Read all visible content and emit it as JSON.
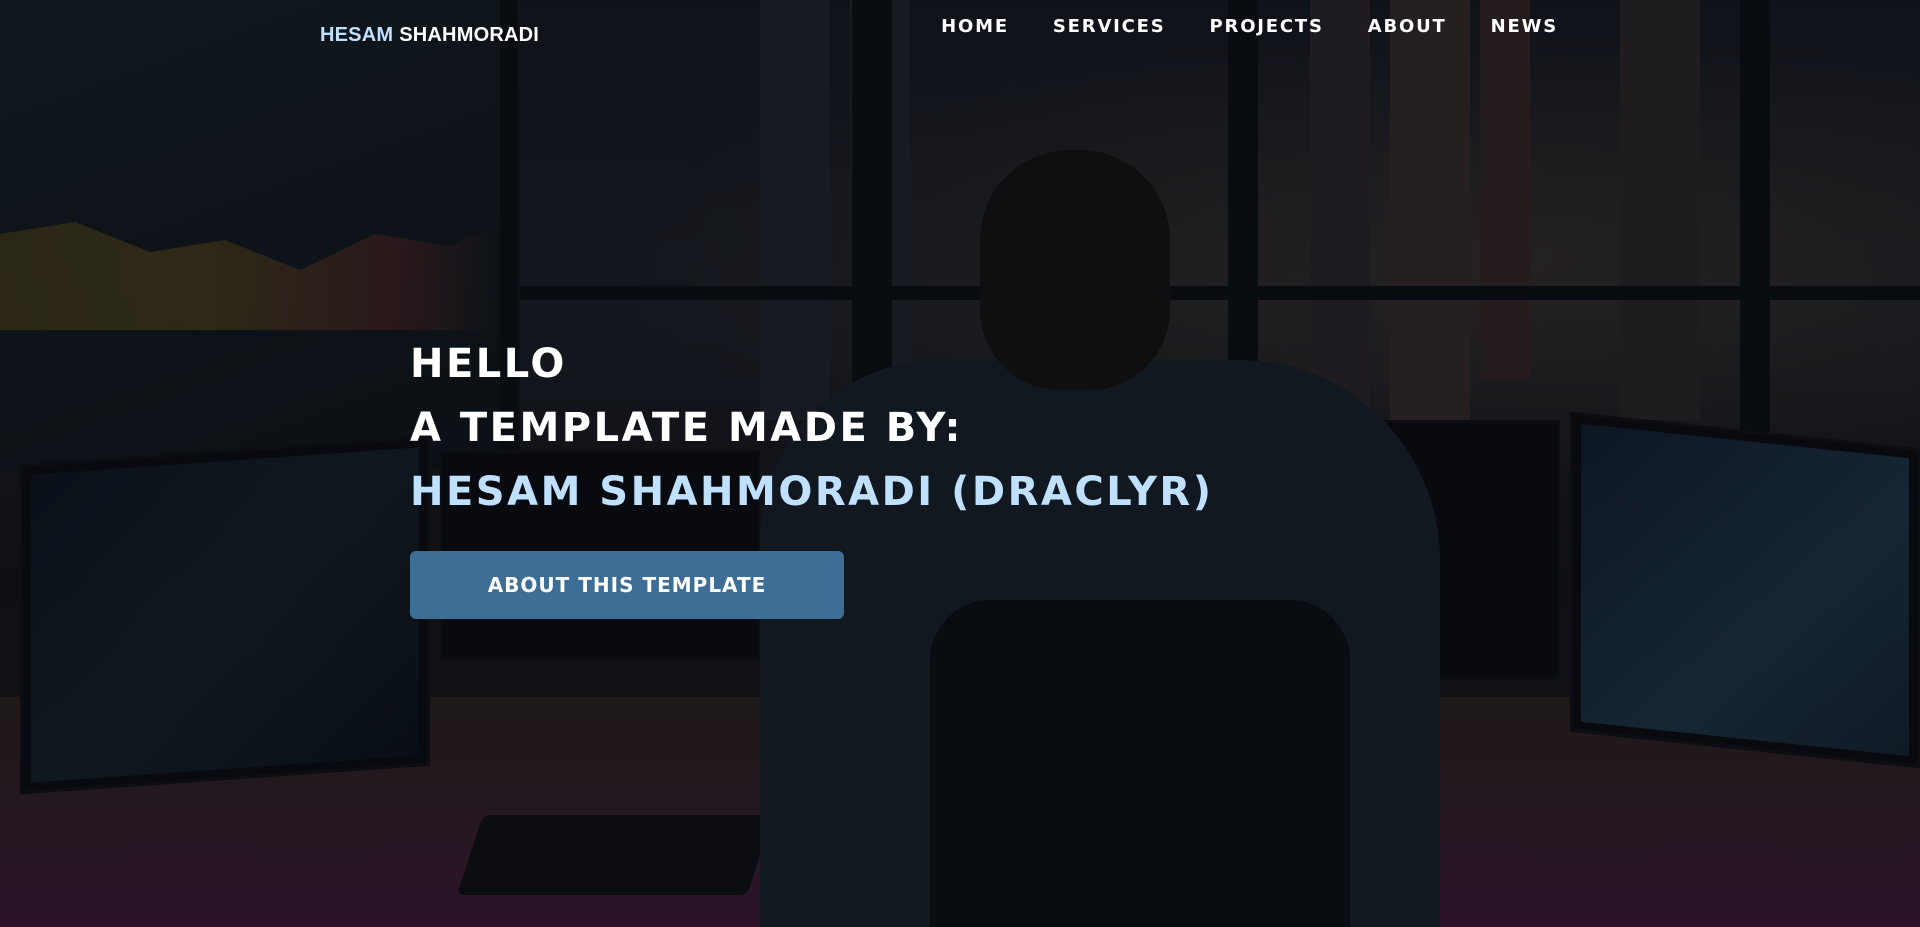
{
  "header": {
    "logo": {
      "first": "HESAM",
      "last": "SHAHMORADI"
    },
    "nav": [
      {
        "label": "HOME"
      },
      {
        "label": "SERVICES"
      },
      {
        "label": "PROJECTS"
      },
      {
        "label": "ABOUT"
      },
      {
        "label": "NEWS"
      }
    ]
  },
  "hero": {
    "line1": "HELLO",
    "line2": "A TEMPLATE MADE BY:",
    "line3": "HESAM SHAHMORADI (DRACLYR)",
    "cta_label": "ABOUT THIS TEMPLATE"
  },
  "colors": {
    "accent_text": "#bfe0ff",
    "button_bg": "#3e6e95",
    "text": "#ffffff"
  },
  "background": {
    "icon": "office-city-trading-desk-image"
  }
}
